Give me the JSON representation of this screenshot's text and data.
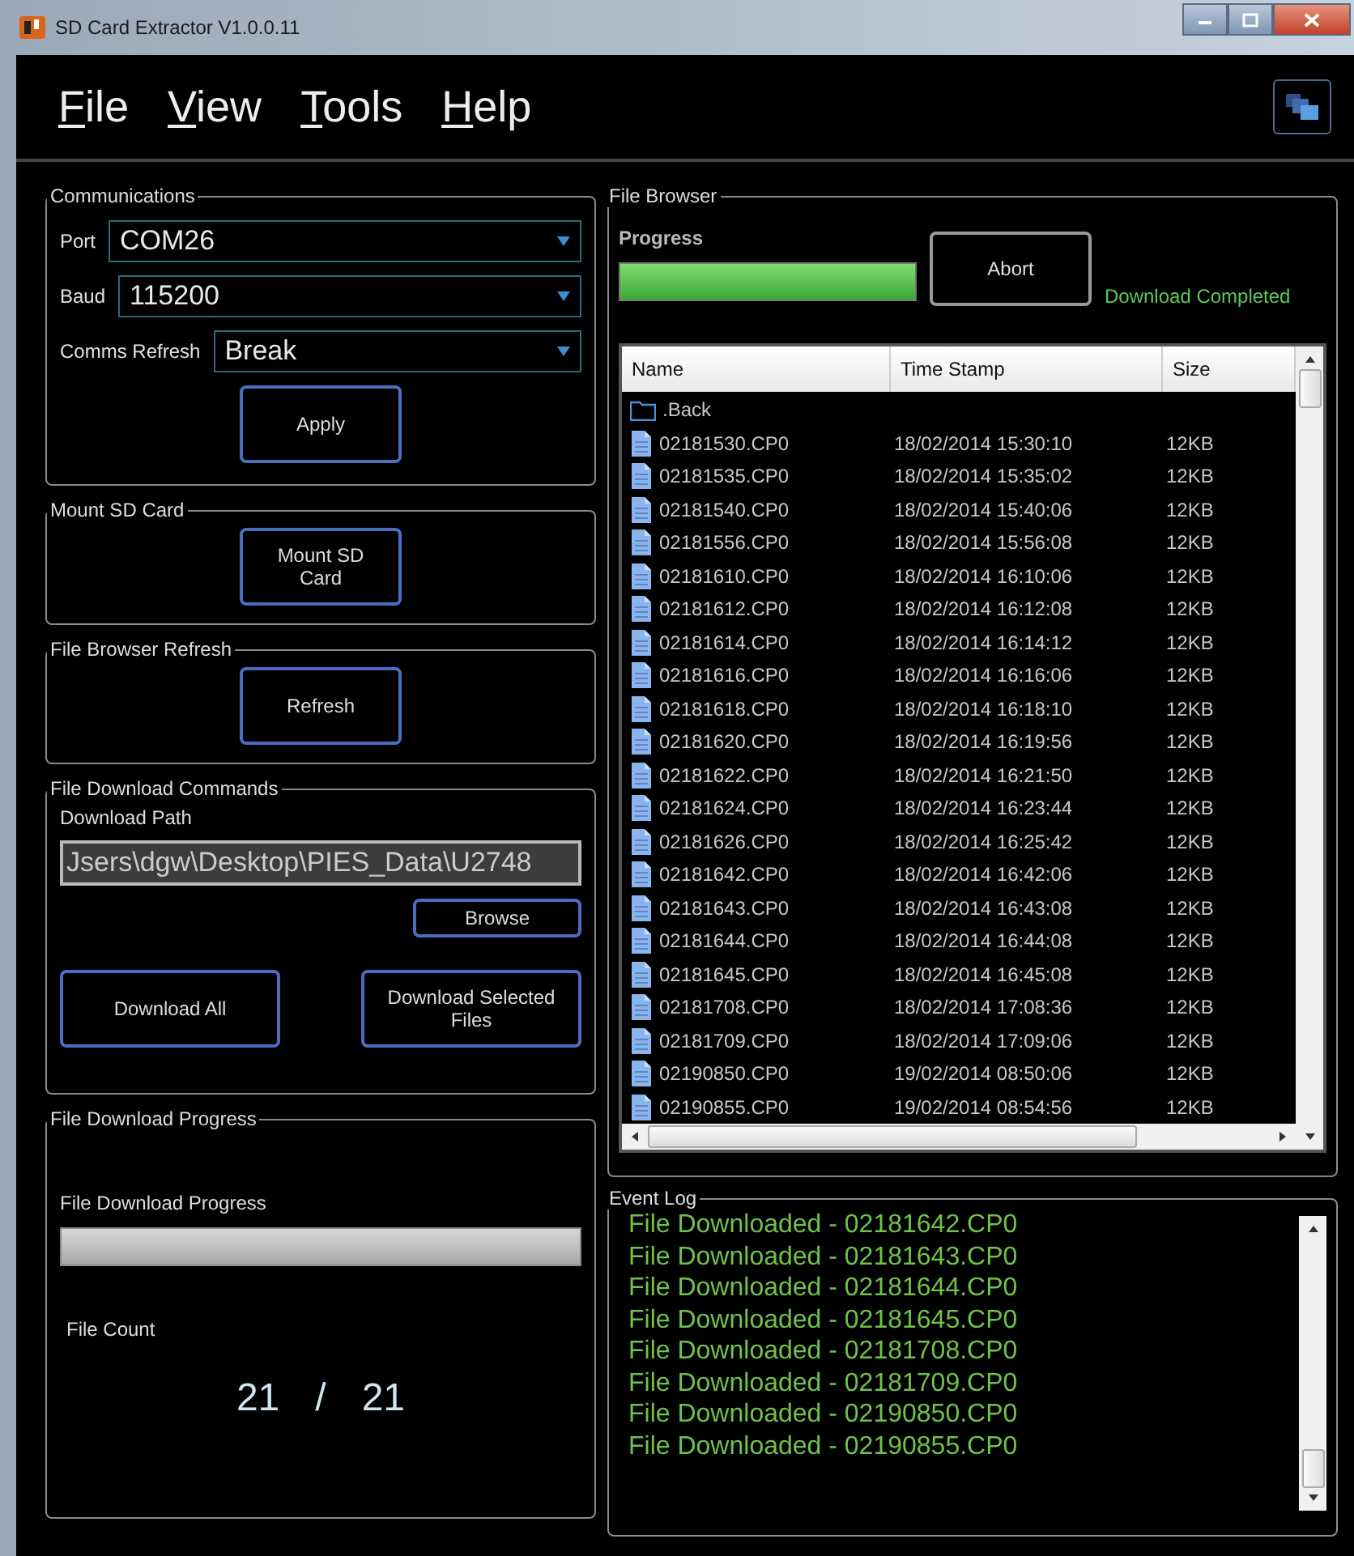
{
  "window": {
    "title": "SD Card Extractor V1.0.0.11"
  },
  "menu": [
    {
      "label": "File"
    },
    {
      "label": "View"
    },
    {
      "label": "Tools"
    },
    {
      "label": "Help"
    }
  ],
  "communications": {
    "title": "Communications",
    "fields": [
      {
        "label": "Port",
        "value": "COM26"
      },
      {
        "label": "Baud",
        "value": "115200"
      },
      {
        "label": "Comms Refresh",
        "value": "Break"
      }
    ],
    "button": "Apply"
  },
  "mount": {
    "title": "Mount SD Card",
    "button": "Mount SD Card"
  },
  "browser_refresh": {
    "title": "File Browser Refresh",
    "button": "Refresh"
  },
  "download_commands": {
    "title": "File Download Commands",
    "path_label": "Download Path",
    "path_value": "Jsers\\dgw\\Desktop\\PIES_Data\\U2748",
    "browse": "Browse",
    "buttons": [
      "Download All",
      "Download Selected Files"
    ]
  },
  "download_progress": {
    "title": "File Download Progress",
    "label": "File Download Progress",
    "level": 0,
    "count_label": "File Count",
    "count_done": "21",
    "separator": "/",
    "count_total": "21"
  },
  "file_browser": {
    "title": "File Browser",
    "progress_label": "Progress",
    "level": 1,
    "abort": "Abort",
    "status": "Download Completed",
    "columns": [
      "Name",
      "Time Stamp",
      "Size"
    ],
    "rows": [
      {
        "kind": "folder",
        "name": ".Back"
      },
      {
        "kind": "file",
        "name": "02181530.CP0",
        "time": "18/02/2014 15:30:10",
        "size": "12KB"
      },
      {
        "kind": "file",
        "name": "02181535.CP0",
        "time": "18/02/2014 15:35:02",
        "size": "12KB"
      },
      {
        "kind": "file",
        "name": "02181540.CP0",
        "time": "18/02/2014 15:40:06",
        "size": "12KB"
      },
      {
        "kind": "file",
        "name": "02181556.CP0",
        "time": "18/02/2014 15:56:08",
        "size": "12KB"
      },
      {
        "kind": "file",
        "name": "02181610.CP0",
        "time": "18/02/2014 16:10:06",
        "size": "12KB"
      },
      {
        "kind": "file",
        "name": "02181612.CP0",
        "time": "18/02/2014 16:12:08",
        "size": "12KB"
      },
      {
        "kind": "file",
        "name": "02181614.CP0",
        "time": "18/02/2014 16:14:12",
        "size": "12KB"
      },
      {
        "kind": "file",
        "name": "02181616.CP0",
        "time": "18/02/2014 16:16:06",
        "size": "12KB"
      },
      {
        "kind": "file",
        "name": "02181618.CP0",
        "time": "18/02/2014 16:18:10",
        "size": "12KB"
      },
      {
        "kind": "file",
        "name": "02181620.CP0",
        "time": "18/02/2014 16:19:56",
        "size": "12KB"
      },
      {
        "kind": "file",
        "name": "02181622.CP0",
        "time": "18/02/2014 16:21:50",
        "size": "12KB"
      },
      {
        "kind": "file",
        "name": "02181624.CP0",
        "time": "18/02/2014 16:23:44",
        "size": "12KB"
      },
      {
        "kind": "file",
        "name": "02181626.CP0",
        "time": "18/02/2014 16:25:42",
        "size": "12KB"
      },
      {
        "kind": "file",
        "name": "02181642.CP0",
        "time": "18/02/2014 16:42:06",
        "size": "12KB"
      },
      {
        "kind": "file",
        "name": "02181643.CP0",
        "time": "18/02/2014 16:43:08",
        "size": "12KB"
      },
      {
        "kind": "file",
        "name": "02181644.CP0",
        "time": "18/02/2014 16:44:08",
        "size": "12KB"
      },
      {
        "kind": "file",
        "name": "02181645.CP0",
        "time": "18/02/2014 16:45:08",
        "size": "12KB"
      },
      {
        "kind": "file",
        "name": "02181708.CP0",
        "time": "18/02/2014 17:08:36",
        "size": "12KB"
      },
      {
        "kind": "file",
        "name": "02181709.CP0",
        "time": "18/02/2014 17:09:06",
        "size": "12KB"
      },
      {
        "kind": "file",
        "name": "02190850.CP0",
        "time": "19/02/2014 08:50:06",
        "size": "12KB"
      },
      {
        "kind": "file",
        "name": "02190855.CP0",
        "time": "19/02/2014 08:54:56",
        "size": "12KB"
      }
    ]
  },
  "event_log": {
    "title": "Event Log",
    "lines": [
      "File Downloaded - 02181642.CP0",
      "File Downloaded - 02181643.CP0",
      "File Downloaded - 02181644.CP0",
      "File Downloaded - 02181645.CP0",
      "File Downloaded - 02181708.CP0",
      "File Downloaded - 02181709.CP0",
      "File Downloaded - 02190850.CP0",
      "File Downloaded - 02190855.CP0"
    ]
  }
}
